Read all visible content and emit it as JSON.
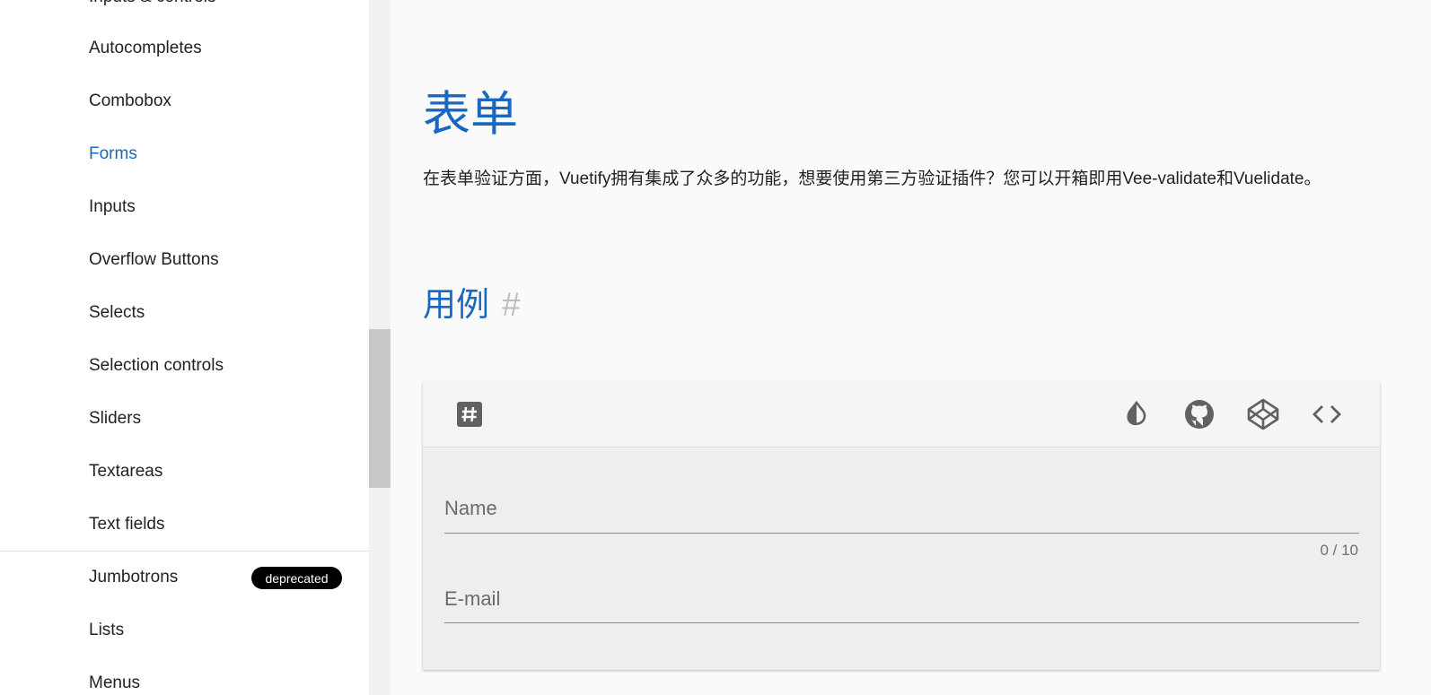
{
  "sidebar": {
    "items": [
      {
        "label": "Inputs & controls"
      },
      {
        "label": "Autocompletes"
      },
      {
        "label": "Combobox"
      },
      {
        "label": "Forms"
      },
      {
        "label": "Inputs"
      },
      {
        "label": "Overflow Buttons"
      },
      {
        "label": "Selects"
      },
      {
        "label": "Selection controls"
      },
      {
        "label": "Sliders"
      },
      {
        "label": "Textareas"
      },
      {
        "label": "Text fields"
      },
      {
        "label": "Jumbotrons",
        "badge": "deprecated"
      },
      {
        "label": "Lists"
      },
      {
        "label": "Menus"
      }
    ],
    "active": "Forms"
  },
  "main": {
    "title": "表单",
    "intro": "在表单验证方面，Vuetify拥有集成了众多的功能，想要使用第三方验证插件？您可以开箱即用Vee-validate和Vuelidate。",
    "section_title": "用例",
    "section_anchor": "#"
  },
  "example": {
    "toolbar_icons": [
      "pound-box-icon",
      "invert-colors-icon",
      "github-icon",
      "codepen-icon",
      "code-tags-icon"
    ],
    "fields": [
      {
        "label": "Name",
        "counter": "0 / 10"
      },
      {
        "label": "E-mail"
      }
    ]
  },
  "colors": {
    "accent": "#1867c0",
    "badge_bg": "#000000"
  }
}
